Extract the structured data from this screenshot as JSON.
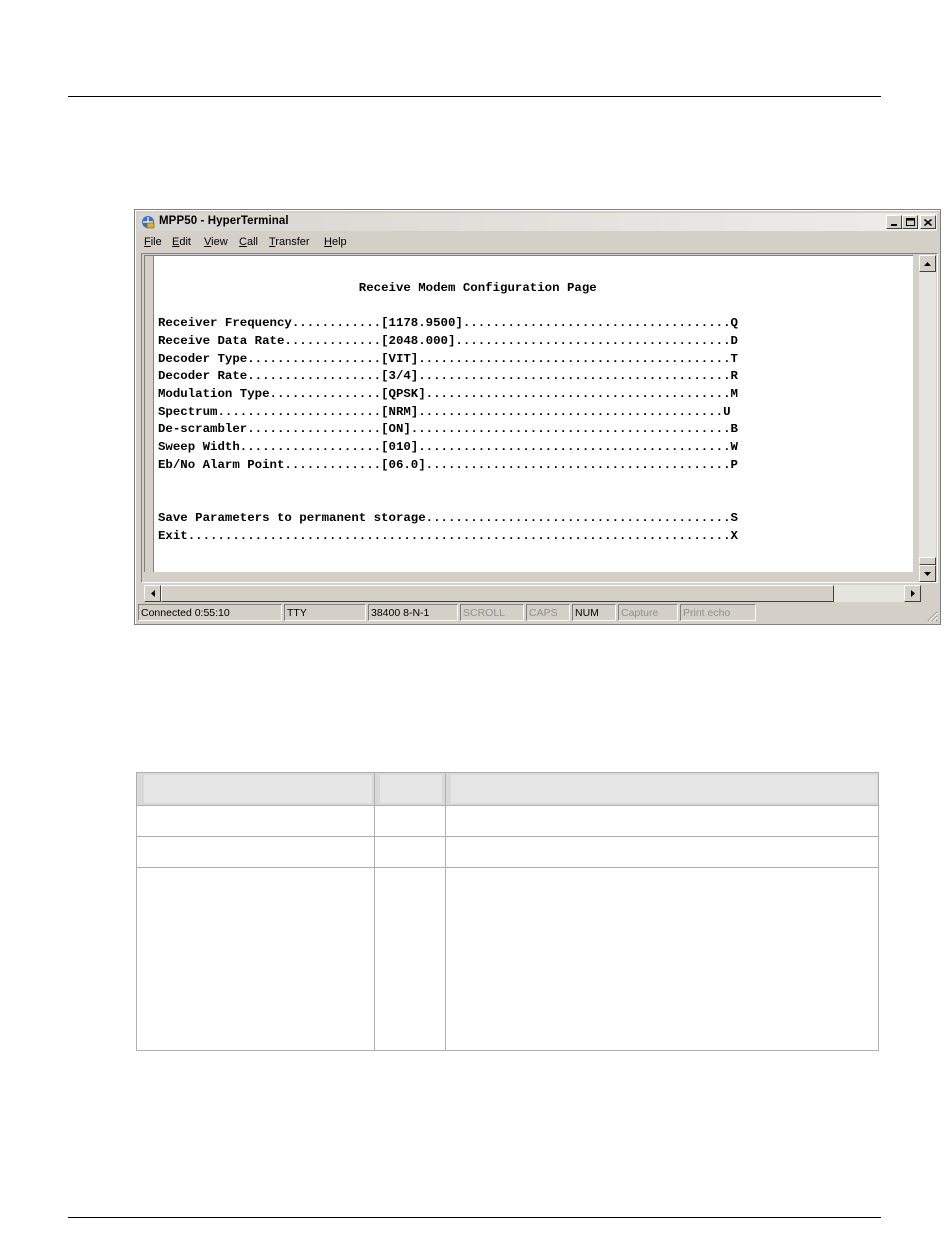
{
  "window": {
    "title": "MPP50 - HyperTerminal",
    "menu": [
      "File",
      "Edit",
      "View",
      "Call",
      "Transfer",
      "Help"
    ]
  },
  "terminal": {
    "lines": [
      "",
      "                           Receive Modem Configuration Page",
      "",
      "Receiver Frequency............[1178.9500]....................................Q",
      "Receive Data Rate.............[2048.000].....................................D",
      "Decoder Type..................[VIT]..........................................T",
      "Decoder Rate..................[3/4]..........................................R",
      "Modulation Type...............[QPSK].........................................M",
      "Spectrum......................[NRM].........................................U",
      "De-scrambler..................[ON]...........................................B",
      "Sweep Width...................[010]..........................................W",
      "Eb/No Alarm Point.............[06.0].........................................P",
      "",
      "",
      "Save Parameters to permanent storage.........................................S",
      "Exit.........................................................................X"
    ]
  },
  "statusbar": {
    "connected": "Connected 0:55:10",
    "emulation": "TTY",
    "port": "38400 8-N-1",
    "scroll": "SCROLL",
    "caps": "CAPS",
    "num": "NUM",
    "capture": "Capture",
    "print_echo": "Print echo"
  }
}
